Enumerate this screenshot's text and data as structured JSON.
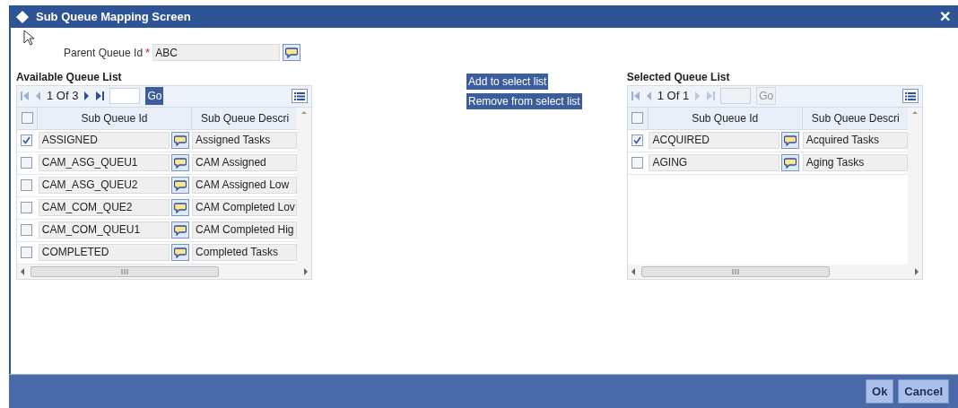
{
  "window": {
    "title": "Sub Queue Mapping Screen",
    "close": "✕"
  },
  "parent_queue": {
    "label": "Parent Queue Id",
    "required": "*",
    "value": "ABC"
  },
  "available": {
    "title": "Available Queue List",
    "pager": {
      "page": "1 Of 3",
      "disabled": false,
      "go": "Go"
    },
    "header_checked": false,
    "columns": [
      "Sub Queue Id",
      "Sub Queue Descri"
    ],
    "rows": [
      {
        "checked": true,
        "id": "ASSIGNED",
        "description": "Assigned Tasks"
      },
      {
        "checked": false,
        "id": "CAM_ASG_QUEU1",
        "description": "CAM Assigned"
      },
      {
        "checked": false,
        "id": "CAM_ASG_QUEU2",
        "description": "CAM Assigned Low"
      },
      {
        "checked": false,
        "id": "CAM_COM_QUE2",
        "description": "CAM Completed Lov"
      },
      {
        "checked": false,
        "id": "CAM_COM_QUEU1",
        "description": "CAM Completed Hig"
      },
      {
        "checked": false,
        "id": "COMPLETED",
        "description": "Completed Tasks"
      }
    ]
  },
  "actions": [
    "Add to select list",
    "Remove from select list"
  ],
  "selected": {
    "title": "Selected Queue List",
    "pager": {
      "page": "1 Of 1",
      "disabled": true,
      "go": "Go"
    },
    "header_checked": false,
    "columns": [
      "Sub Queue Id",
      "Sub Queue Descri"
    ],
    "rows": [
      {
        "checked": true,
        "id": "ACQUIRED",
        "description": "Acquired Tasks"
      },
      {
        "checked": false,
        "id": "AGING",
        "description": "Aging Tasks"
      }
    ]
  },
  "buttons": [
    "Ok",
    "Cancel"
  ]
}
